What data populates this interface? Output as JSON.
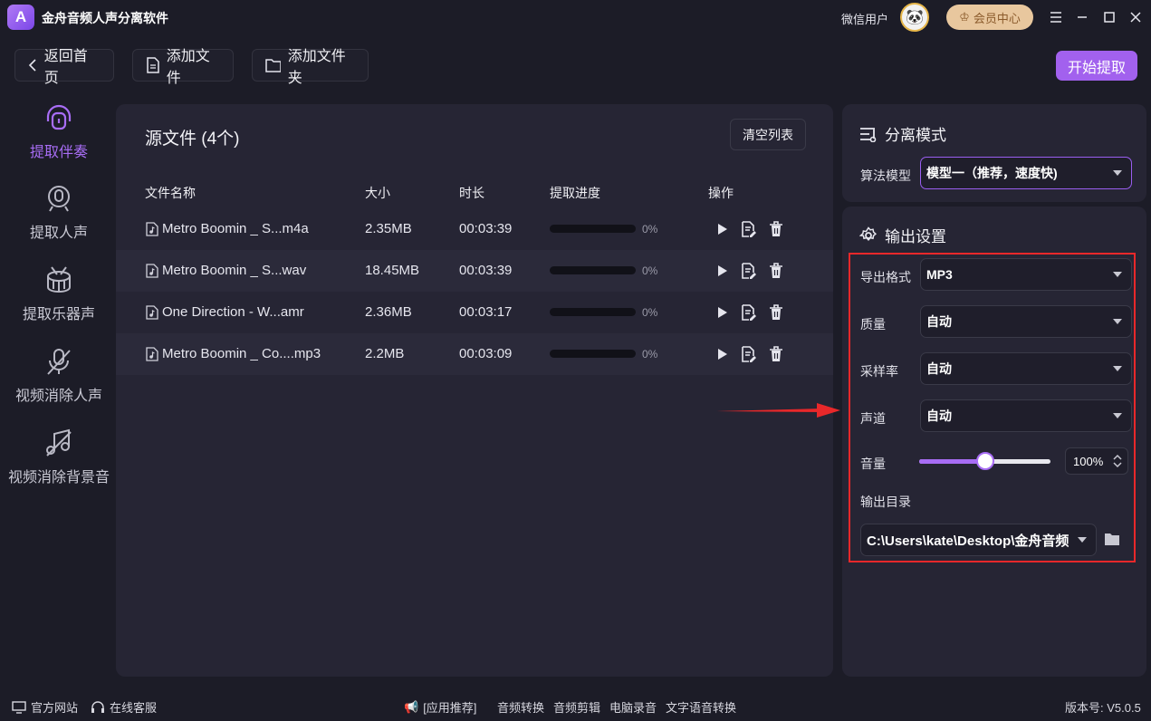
{
  "app": {
    "logo_letter": "A",
    "title": "金舟音频人声分离软件"
  },
  "titlebar": {
    "user_name": "微信用户",
    "vip_label": "会员中心"
  },
  "toolbar": {
    "back_label": "返回首页",
    "add_file_label": "添加文件",
    "add_folder_label": "添加文件夹",
    "start_label": "开始提取"
  },
  "sidebar": {
    "items": [
      {
        "label": "提取伴奏",
        "icon": "headphones-icon",
        "active": true
      },
      {
        "label": "提取人声",
        "icon": "microphone-icon",
        "active": false
      },
      {
        "label": "提取乐器声",
        "icon": "drum-icon",
        "active": false
      },
      {
        "label": "视频消除人声",
        "icon": "mic-off-icon",
        "active": false
      },
      {
        "label": "视频消除背景音",
        "icon": "music-off-icon",
        "active": false
      }
    ]
  },
  "files": {
    "title": "源文件 (4个)",
    "clear_label": "清空列表",
    "columns": [
      "文件名称",
      "大小",
      "时长",
      "提取进度",
      "操作"
    ],
    "rows": [
      {
        "name": "Metro Boomin _ S...m4a",
        "size": "2.35MB",
        "duration": "00:03:39",
        "progress": 0,
        "progress_label": "0%"
      },
      {
        "name": "Metro Boomin _ S...wav",
        "size": "18.45MB",
        "duration": "00:03:39",
        "progress": 0,
        "progress_label": "0%"
      },
      {
        "name": "One Direction - W...amr",
        "size": "2.36MB",
        "duration": "00:03:17",
        "progress": 0,
        "progress_label": "0%"
      },
      {
        "name": "Metro Boomin _ Co....mp3",
        "size": "2.2MB",
        "duration": "00:03:09",
        "progress": 0,
        "progress_label": "0%"
      }
    ]
  },
  "separation": {
    "title": "分离模式",
    "model_label": "算法模型",
    "model_value": "模型一（推荐，速度快)"
  },
  "output": {
    "title": "输出设置",
    "format_label": "导出格式",
    "format_value": "MP3",
    "quality_label": "质量",
    "quality_value": "自动",
    "samplerate_label": "采样率",
    "samplerate_value": "自动",
    "channel_label": "声道",
    "channel_value": "自动",
    "volume_label": "音量",
    "volume_value": "100",
    "volume_unit": "%",
    "volume_fraction": 0.5,
    "dir_label": "输出目录",
    "dir_value": "C:\\Users\\kate\\Desktop\\金舟音频"
  },
  "footer": {
    "website": "官方网站",
    "support": "在线客服",
    "recommend": "[应用推荐]",
    "links": [
      "音频转换",
      "音频剪辑",
      "电脑录音",
      "文字语音转换"
    ],
    "version": "版本号: V5.0.5"
  },
  "colors": {
    "accent": "#a86df5",
    "highlight_box": "#e8282a",
    "arrow": "#e8282a"
  }
}
